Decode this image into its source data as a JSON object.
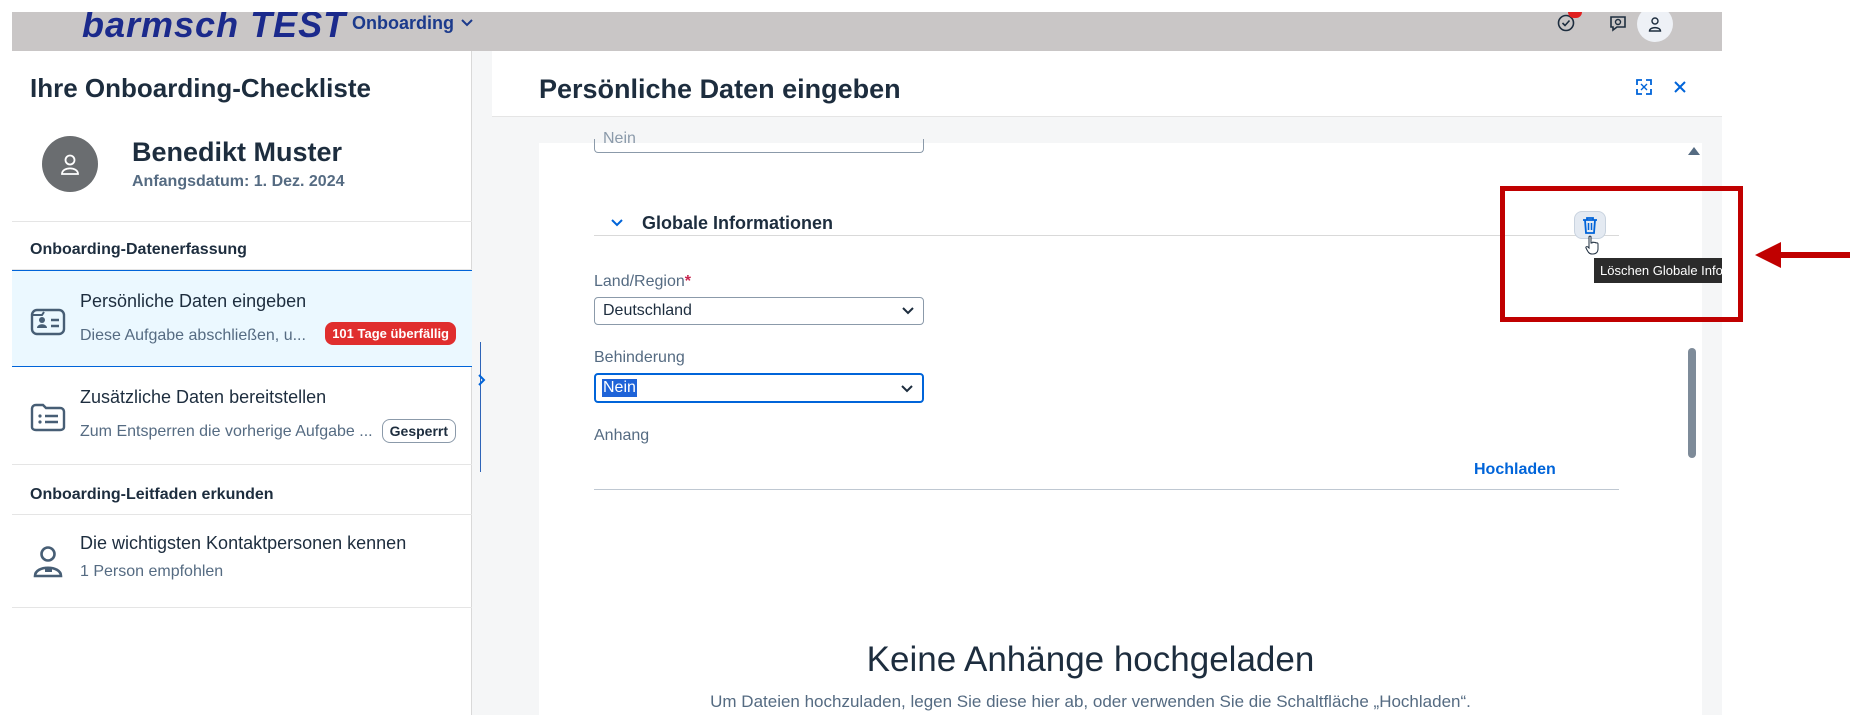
{
  "shell": {
    "logo": "barmsch TEST",
    "app_menu_label": "Onboarding"
  },
  "left_panel": {
    "title": "Ihre Onboarding-Checkliste",
    "profile": {
      "name": "Benedikt Muster",
      "start_date": "Anfangsdatum: 1. Dez. 2024"
    },
    "groups": [
      {
        "title": "Onboarding-Datenerfassung",
        "tasks": [
          {
            "title": "Persönliche Daten eingeben",
            "subtitle": "Diese Aufgabe abschließen, u...",
            "badge": "101 Tage überfällig"
          },
          {
            "title": "Zusätzliche Daten bereitstellen",
            "subtitle": "Zum Entsperren die vorherige Aufgabe ...",
            "badge": "Gesperrt"
          }
        ]
      },
      {
        "title": "Onboarding-Leitfaden erkunden",
        "tasks": [
          {
            "title": "Die wichtigsten Kontaktpersonen kennen",
            "subtitle": "1 Person empfohlen"
          }
        ]
      }
    ]
  },
  "right_panel": {
    "title": "Persönliche Daten eingeben",
    "cut_off_value": "Nein",
    "section_title": "Globale Informationen",
    "delete_tooltip": "Löschen Globale Informationen",
    "fields": {
      "country_label": "Land/Region",
      "country_required": "*",
      "country_value": "Deutschland",
      "disability_label": "Behinderung",
      "disability_value": "Nein",
      "attachment_label": "Anhang"
    },
    "upload_label": "Hochladen",
    "empty_state": {
      "title": "Keine Anhänge hochgeladen",
      "subtitle": "Um Dateien hochzuladen, legen Sie diese hier ab, oder verwenden Sie die Schaltfläche „Hochladen“."
    }
  },
  "colors": {
    "accent": "#0064d9",
    "overdue": "#e02e2e",
    "annotation": "#c00000",
    "shellbar": "#c9c6c6"
  }
}
